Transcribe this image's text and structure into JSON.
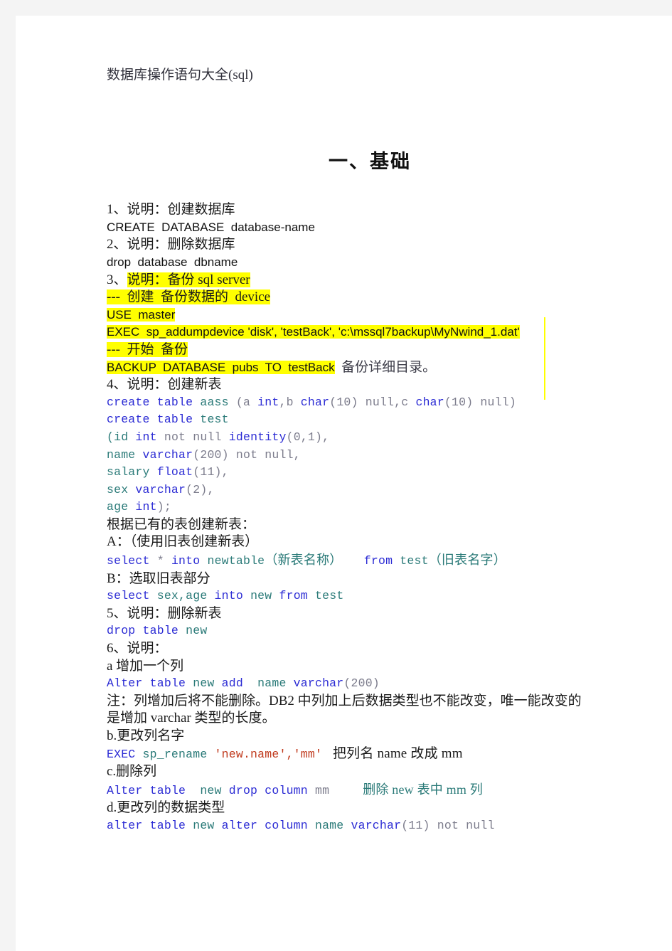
{
  "document": {
    "title": "数据库操作语句大全(sql)",
    "heading": "一、基础"
  },
  "lines": {
    "l1_label": "1、说明：创建数据库",
    "l1_code": "CREATE  DATABASE  database-name",
    "l2_label": "2、说明：删除数据库",
    "l2_code": "drop  database  dbname",
    "l3_num": "3、",
    "l3_label": "说明：备份 sql server",
    "l3_c1": "---  创建  备份数据的  device",
    "l3_c2": "USE  master",
    "l3_c3": "EXEC  sp_addumpdevice 'disk', 'testBack', 'c:\\mssql7backup\\MyNwind_1.dat'",
    "l3_c4": "---  开始  备份",
    "l3_c5": "BACKUP  DATABASE  pubs  TO  testBack",
    "l3_c5_note": "备份详细目录。",
    "l4_label": "4、说明：创建新表",
    "l4_a1": "create table",
    "l4_a2": " aass ",
    "l4_a3": "(a ",
    "l4_a4": "int",
    "l4_a5": ",b ",
    "l4_a6": "char",
    "l4_a7": "(10) ",
    "l4_a8": "null",
    "l4_a9": ",c ",
    "l4_a10": "char",
    "l4_a11": "(10) ",
    "l4_a12": "null",
    "l4_a13": ")",
    "l4_b1": "create table",
    "l4_b2": " test",
    "l4_c1": "(id ",
    "l4_c2": "int",
    "l4_c3": " not null ",
    "l4_c4": "identity",
    "l4_c5": "(0,1),",
    "l4_d1": "name ",
    "l4_d2": "varchar",
    "l4_d3": "(200) ",
    "l4_d4": "not null,",
    "l4_e1": "salary ",
    "l4_e2": "float",
    "l4_e3": "(11),",
    "l4_f1": "sex ",
    "l4_f2": "varchar",
    "l4_f3": "(2),",
    "l4_g1": "age ",
    "l4_g2": "int",
    "l4_g3": ");",
    "l4_note1": "根据已有的表创建新表：",
    "l4_note2": "A：（使用旧表创建新表）",
    "l4_h1": "select",
    "l4_h2": " * ",
    "l4_h3": "into",
    "l4_h4": " newtable",
    "l4_h5": "（新表名称）",
    "l4_h6": "   from",
    "l4_h7": " test",
    "l4_h8": "（旧表名字）",
    "l4_note3": "B：选取旧表部分",
    "l4_i1": "select",
    "l4_i2": " sex,age ",
    "l4_i3": "into",
    "l4_i4": " new ",
    "l4_i5": "from",
    "l4_i6": " test",
    "l5_label": "5、说明：删除新表",
    "l5_c1": "drop table",
    "l5_c2": " new",
    "l6_label": "6、说明：",
    "l6_a_label": "a 增加一个列",
    "l6_a1": "Alter table",
    "l6_a2": " new ",
    "l6_a3": "add",
    "l6_a4": "  name ",
    "l6_a5": "varchar",
    "l6_a6": "(200)",
    "l6_note1": "注：列增加后将不能删除。DB2 中列加上后数据类型也不能改变，唯一能改变的",
    "l6_note2": "是增加 varchar 类型的长度。",
    "l6_b_label": "b.更改列名字",
    "l6_b1": "EXEC",
    "l6_b2": " sp_rename ",
    "l6_b3": "'new.name','mm'",
    "l6_b_note": "把列名 name 改成 mm",
    "l6_c_label": "c.删除列",
    "l6_c1": "Alter table",
    "l6_c2": "  new ",
    "l6_c3": "drop column",
    "l6_c4": " mm",
    "l6_c_note": "删除 new 表中 mm 列",
    "l6_d_label": "d.更改列的数据类型",
    "l6_d1": "alter table",
    "l6_d2": " new ",
    "l6_d3": "alter column",
    "l6_d4": " name ",
    "l6_d5": "varchar",
    "l6_d6": "(11) ",
    "l6_d7": "not null"
  },
  "colors": {
    "page_background": "#ffffff",
    "canvas_background": "#f4f4f4",
    "highlight": "#ffff00",
    "keyword_blue": "#2b2bd4",
    "identifier_teal": "#2a7a78",
    "string_red": "#c03a1d",
    "dim_gray": "#7c7c8c"
  }
}
